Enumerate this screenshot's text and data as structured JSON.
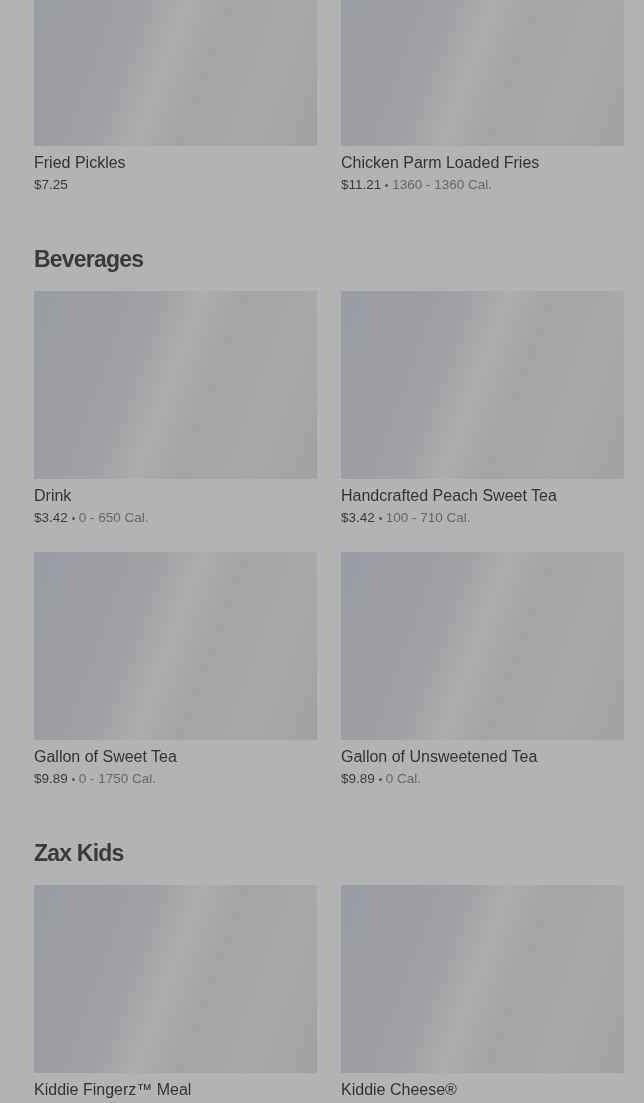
{
  "sections": [
    {
      "items": [
        {
          "name": "Fried Pickles",
          "price": "$7.25"
        },
        {
          "name": "Chicken Parm Loaded Fries",
          "price": "$11.21",
          "calories": "1360 - 1360 Cal."
        }
      ]
    },
    {
      "title": "Beverages",
      "items": [
        {
          "name": "Drink",
          "price": "$3.42",
          "calories": "0 - 650 Cal."
        },
        {
          "name": "Handcrafted Peach Sweet Tea",
          "price": "$3.42",
          "calories": "100 - 710 Cal."
        },
        {
          "name": "Gallon of Sweet Tea",
          "price": "$9.89",
          "calories": "0 - 1750 Cal."
        },
        {
          "name": "Gallon of Unsweetened Tea",
          "price": "$9.89",
          "calories": "0 Cal."
        }
      ]
    },
    {
      "title": "Zax Kids",
      "items": [
        {
          "name": "Kiddie Fingerz™ Meal"
        },
        {
          "name": "Kiddie Cheese®"
        }
      ]
    }
  ]
}
